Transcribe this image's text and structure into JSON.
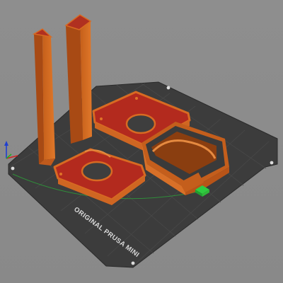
{
  "viewport": {
    "bed_label": "ORIGINAL PRUSA MINI",
    "colors": {
      "background": "#8c8c8c",
      "bed": "#3a3a3a",
      "model_orange": "#d2691e",
      "model_dark": "#8a3e10",
      "top_layer_red": "#b03020",
      "axis_x": "#d02020",
      "axis_y": "#20b020",
      "axis_z": "#2040d0"
    },
    "icons": [
      "axes-icon",
      "origin-icon"
    ]
  }
}
